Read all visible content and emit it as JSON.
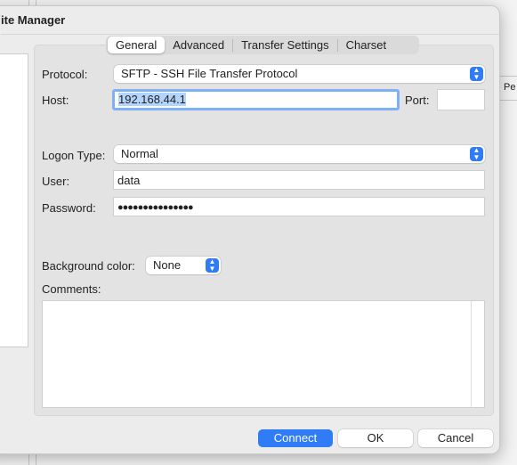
{
  "window": {
    "title": "ite Manager"
  },
  "tabs": [
    {
      "label": "General",
      "active": true
    },
    {
      "label": "Advanced"
    },
    {
      "label": "Transfer Settings"
    },
    {
      "label": "Charset"
    }
  ],
  "form": {
    "protocol_label": "Protocol:",
    "protocol_value": "SFTP - SSH File Transfer Protocol",
    "host_label": "Host:",
    "host_value": "192.168.44.1",
    "port_label": "Port:",
    "port_value": "",
    "logon_label": "Logon Type:",
    "logon_value": "Normal",
    "user_label": "User:",
    "user_value": "data",
    "password_label": "Password:",
    "password_value": "●●●●●●●●●●●●●●●",
    "bgcolor_label": "Background color:",
    "bgcolor_value": "None",
    "comments_label": "Comments:",
    "comments_value": ""
  },
  "buttons": {
    "connect": "Connect",
    "ok": "OK",
    "cancel": "Cancel"
  },
  "background": {
    "column_label": "Pe"
  },
  "colors": {
    "accent": "#2f7cf6",
    "selection": "#b3d4fd"
  }
}
